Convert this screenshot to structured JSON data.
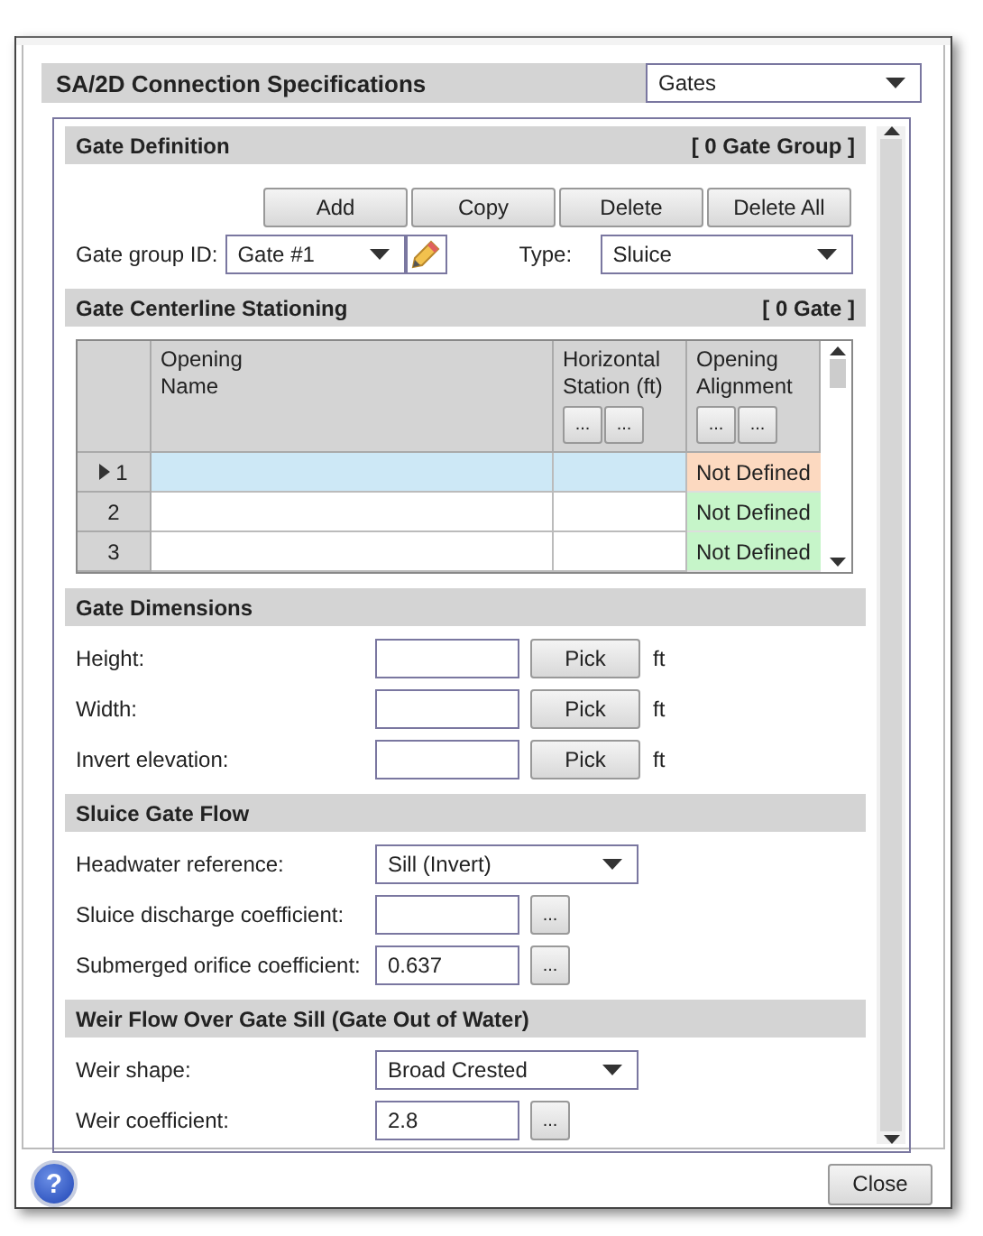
{
  "header": {
    "title": "SA/2D Connection Specifications",
    "value": "Gates"
  },
  "gate_definition": {
    "title": "Gate Definition",
    "count": "[ 0 Gate Group ]",
    "buttons": [
      "Add",
      "Copy",
      "Delete",
      "Delete All"
    ],
    "group_id_label": "Gate group ID:",
    "group_id": "Gate #1",
    "type_label": "Type:",
    "type": "Sluice"
  },
  "stationing": {
    "title": "Gate Centerline Stationing",
    "count": "[ 0 Gate ]",
    "columns": [
      {
        "lines": [
          "Opening",
          "Name"
        ]
      },
      {
        "lines": [
          "Horizontal",
          "Station (ft)"
        ],
        "buttons": [
          "...",
          "..."
        ]
      },
      {
        "lines": [
          "Opening",
          "Alignment"
        ],
        "buttons": [
          "...",
          "..."
        ]
      }
    ],
    "rows": [
      {
        "number": "1",
        "selected": true,
        "alignment": "Not Defined",
        "color": "#fcd9c0"
      },
      {
        "number": "2",
        "selected": false,
        "alignment": "Not Defined",
        "color": "#c6f5c9"
      },
      {
        "number": "3",
        "selected": false,
        "alignment": "Not Defined",
        "color": "#c6f5c9"
      }
    ]
  },
  "sections": [
    {
      "title": "Gate Dimensions",
      "fields": [
        {
          "kind": "pick",
          "label": "Height:",
          "button": "Pick",
          "unit": "ft"
        },
        {
          "kind": "pick",
          "label": "Width:",
          "button": "Pick",
          "unit": "ft"
        },
        {
          "kind": "pick",
          "label": "Invert elevation:",
          "button": "Pick",
          "unit": "ft"
        }
      ]
    },
    {
      "title": "Sluice Gate Flow",
      "fields": [
        {
          "kind": "select",
          "label": "Headwater reference:",
          "value": "Sill (Invert)"
        },
        {
          "kind": "text-button",
          "label": "Sluice discharge coefficient:",
          "button": "..."
        },
        {
          "kind": "text-button",
          "label": "Submerged orifice coefficient:",
          "value": "0.637",
          "button": "..."
        }
      ]
    },
    {
      "title": "Weir Flow Over Gate Sill (Gate Out of Water)",
      "fields": [
        {
          "kind": "select",
          "label": "Weir shape:",
          "value": "Broad Crested"
        },
        {
          "kind": "text-button",
          "label": "Weir coefficient:",
          "value": "2.8",
          "button": "..."
        }
      ]
    }
  ],
  "footer": {
    "help": "?",
    "close": "Close"
  }
}
